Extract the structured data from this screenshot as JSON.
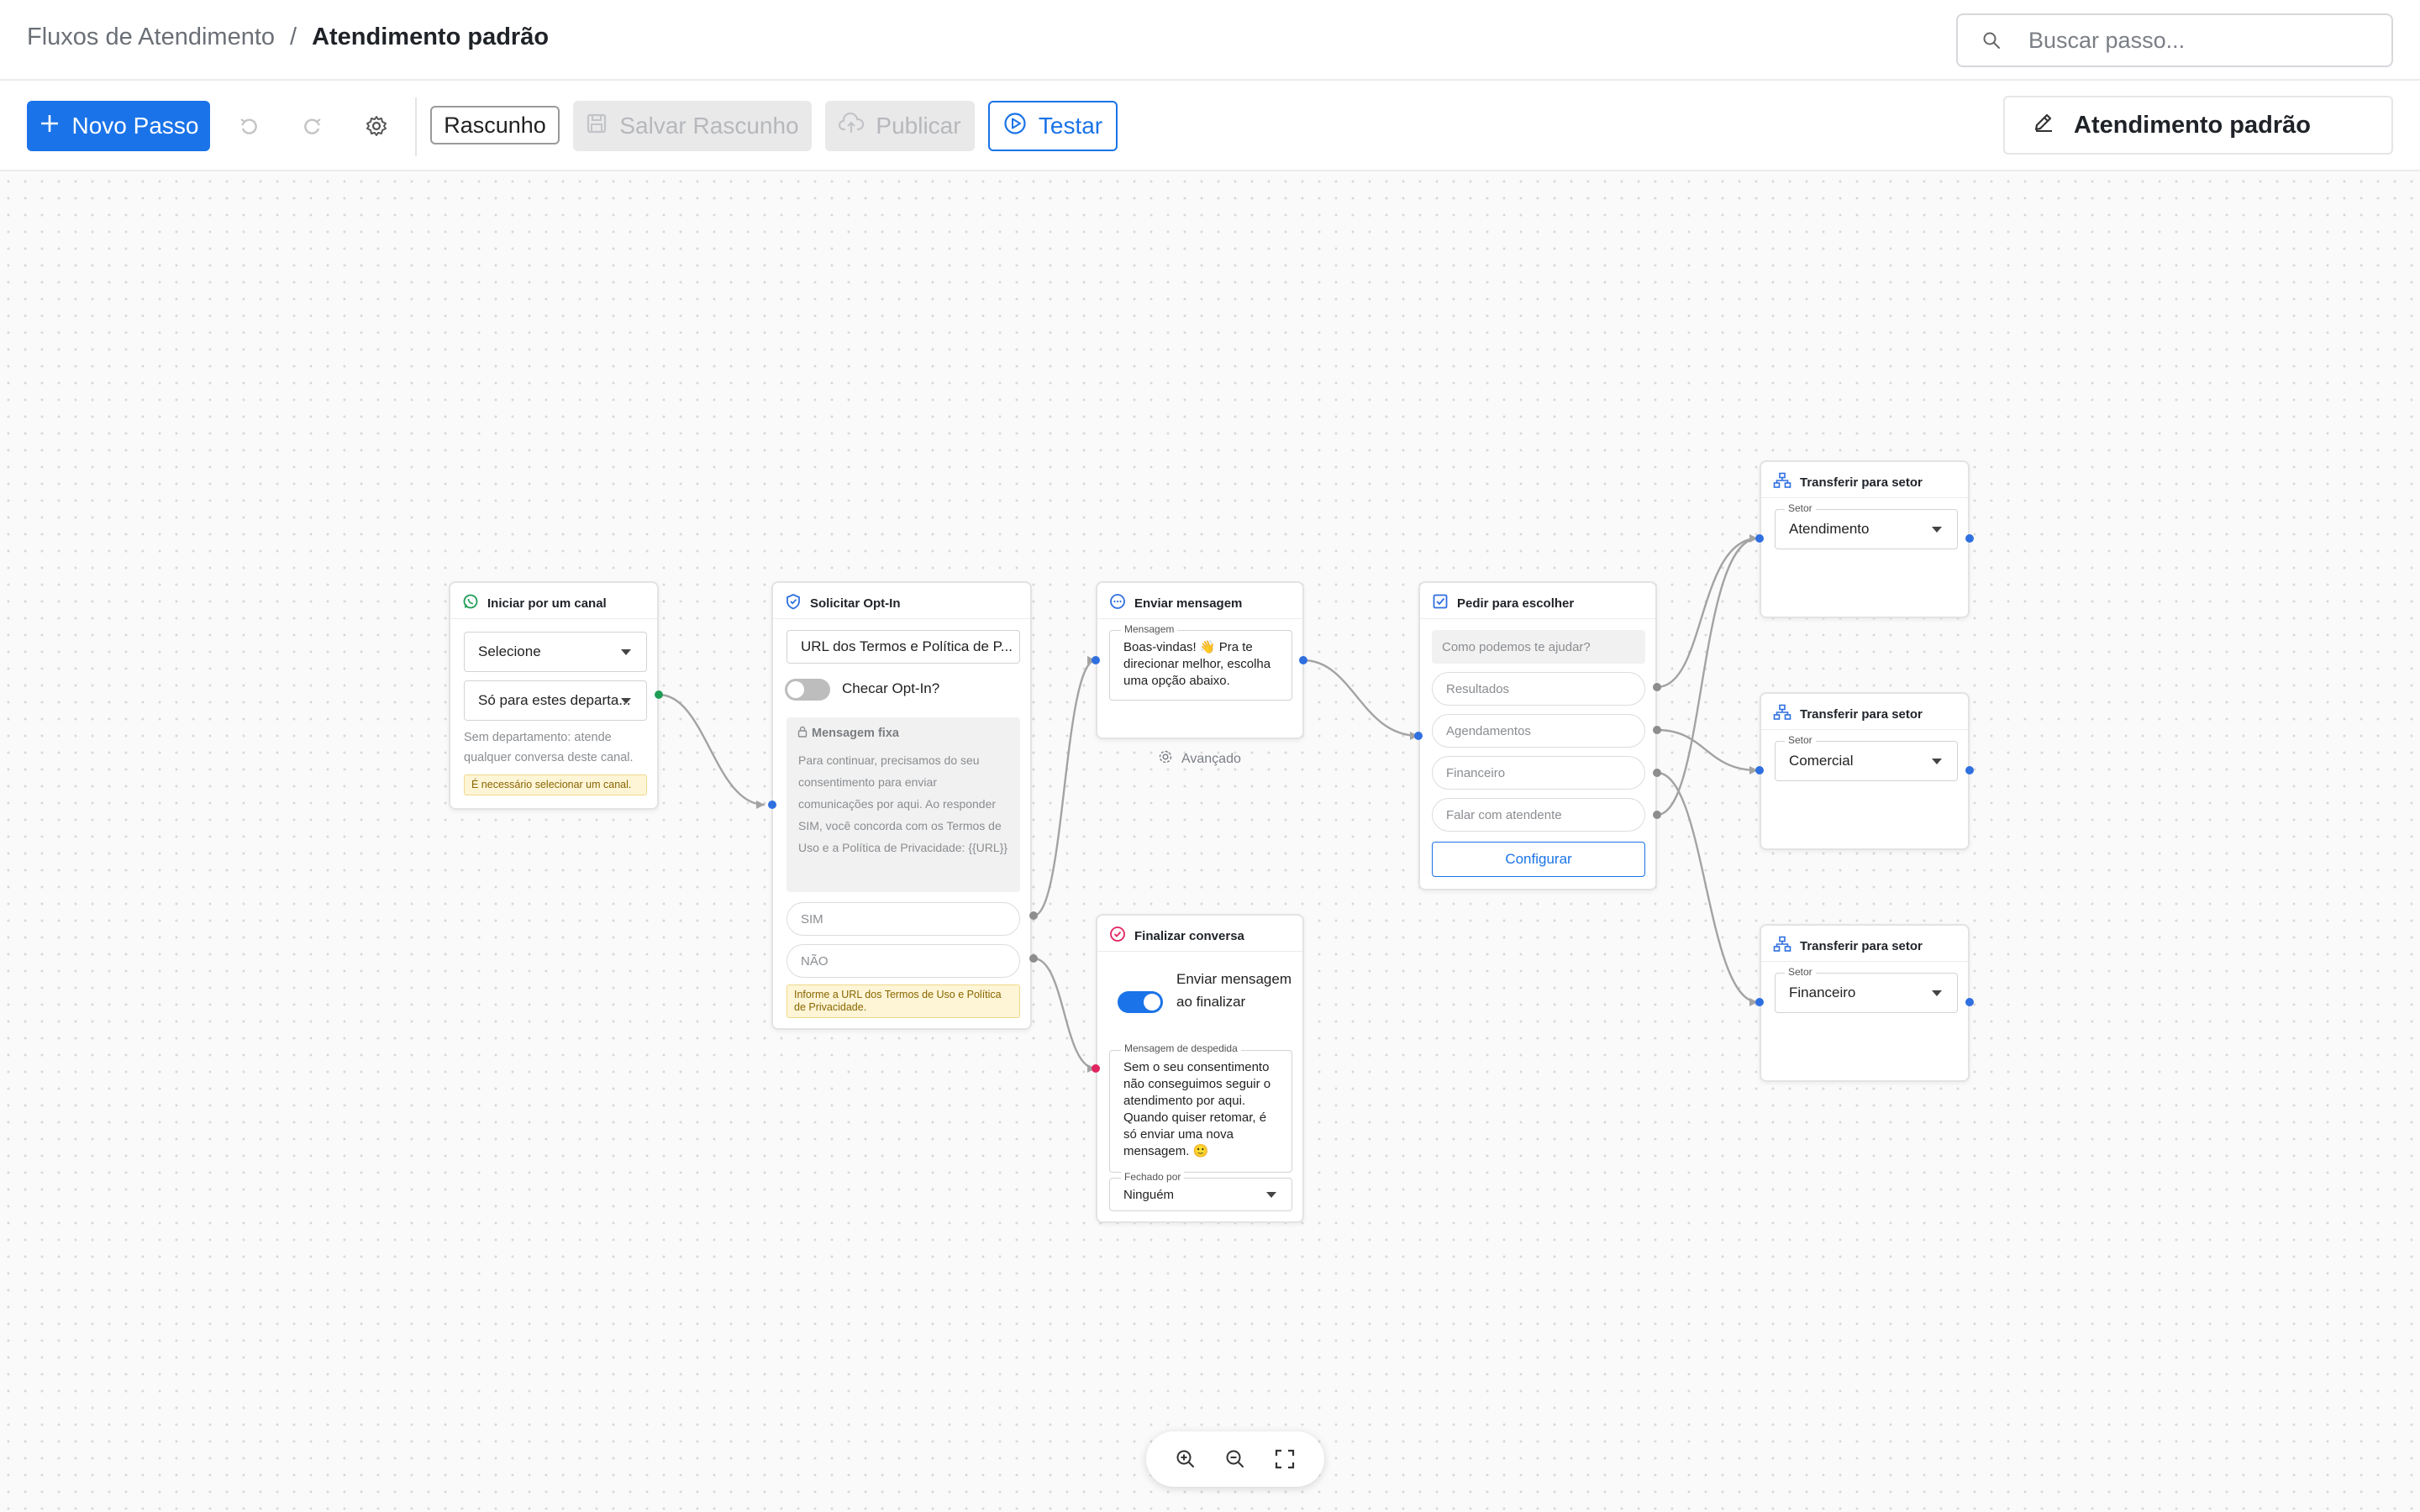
{
  "header": {
    "breadcrumb_root": "Fluxos de Atendimento",
    "breadcrumb_sep": "/",
    "breadcrumb_current": "Atendimento padrão",
    "search_placeholder": "Buscar passo..."
  },
  "toolbar": {
    "new_step_label": "Novo Passo",
    "draft_chip": "Rascunho",
    "save_draft_label": "Salvar Rascunho",
    "publish_label": "Publicar",
    "test_label": "Testar",
    "flow_name": "Atendimento padrão"
  },
  "nodes": {
    "start": {
      "title": "Iniciar por um canal",
      "channel_select": "Selecione",
      "departments_select": "Só para estes departa...",
      "hint": "Sem departamento: atende qualquer conversa deste canal.",
      "warning": "É necessário selecionar um canal."
    },
    "optin": {
      "title": "Solicitar Opt-In",
      "url_field": "URL dos Termos e Política de P...",
      "check_label": "Checar Opt-In?",
      "check_on": false,
      "fixed_title": "Mensagem fixa",
      "fixed_text": "Para continuar, precisamos do seu consentimento para enviar comunicações por aqui. Ao responder SIM, você concorda com os Termos de Uso e a Política de Privacidade: {{URL}}",
      "option_yes": "SIM",
      "option_no": "NÃO",
      "warning": "Informe a URL dos Termos de Uso e Política de Privacidade."
    },
    "send": {
      "title": "Enviar mensagem",
      "msg_label": "Mensagem",
      "msg_text": "Boas-vindas! 👋 Pra te direcionar melhor, escolha uma opção abaixo.",
      "advanced": "Avançado"
    },
    "choose": {
      "title": "Pedir para escolher",
      "question": "Como podemos te ajudar?",
      "options": [
        "Resultados",
        "Agendamentos",
        "Financeiro",
        "Falar com atendente"
      ],
      "configure": "Configurar"
    },
    "end": {
      "title": "Finalizar conversa",
      "toggle_label": "Enviar mensagem ao finalizar",
      "toggle_on": true,
      "msg_label": "Mensagem de despedida",
      "msg_text": "Sem o seu consentimento não conseguimos seguir o atendimento por aqui. Quando quiser retomar, é só enviar uma nova mensagem. 🙂",
      "closed_label": "Fechado por",
      "closed_value": "Ninguém"
    },
    "transfers": [
      {
        "title": "Transferir para setor",
        "label": "Setor",
        "value": "Atendimento"
      },
      {
        "title": "Transferir para setor",
        "label": "Setor",
        "value": "Comercial"
      },
      {
        "title": "Transferir para setor",
        "label": "Setor",
        "value": "Financeiro"
      }
    ]
  },
  "colors": {
    "accent": "#1a73e8",
    "handle_blue": "#2f6fe0",
    "handle_gray": "#8d8d8d",
    "handle_green": "#1f9d55",
    "handle_red": "#e0245e",
    "edge": "#a3a3a3"
  },
  "icons": {
    "new_step": "plus-icon",
    "undo": "undo-icon",
    "redo": "redo-icon",
    "settings": "gear-icon",
    "save": "save-icon",
    "publish": "cloud-upload-icon",
    "test": "play-icon",
    "rename": "pencil-icon",
    "search": "search-icon",
    "zoom_in": "zoom-in-icon",
    "zoom_out": "zoom-out-icon",
    "fit": "fullscreen-icon"
  }
}
